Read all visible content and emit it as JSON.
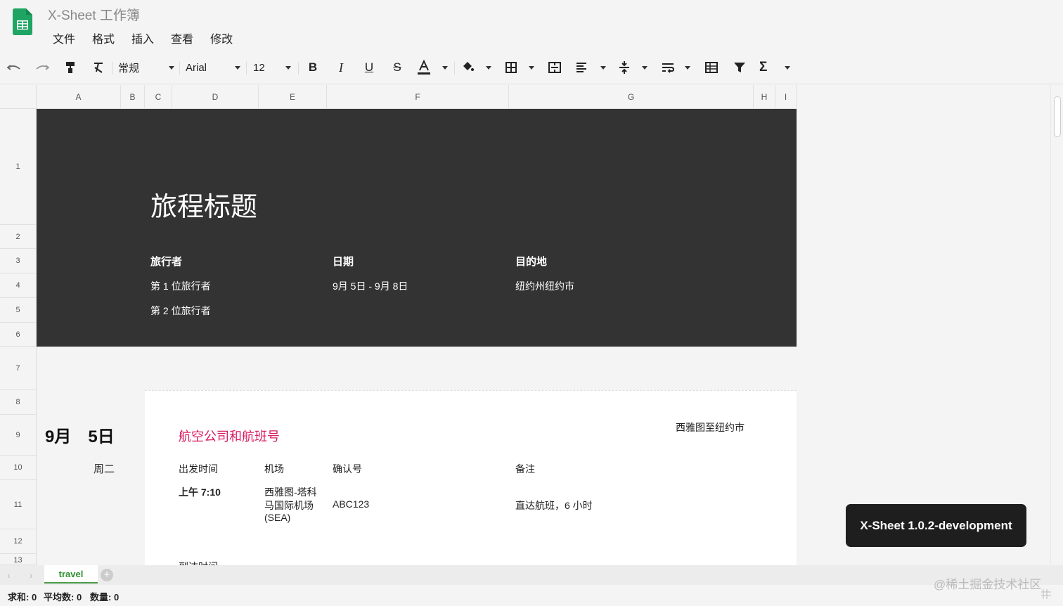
{
  "app": {
    "title": "X-Sheet 工作簿"
  },
  "menu": [
    "文件",
    "格式",
    "插入",
    "查看",
    "修改"
  ],
  "toolbar": {
    "format": "常规",
    "font": "Arial",
    "font_size": "12"
  },
  "columns": [
    "A",
    "B",
    "C",
    "D",
    "E",
    "F",
    "G",
    "H",
    "I"
  ],
  "rows": [
    "1",
    "2",
    "3",
    "4",
    "5",
    "6",
    "7",
    "8",
    "9",
    "10",
    "11",
    "12",
    "13"
  ],
  "sheet": {
    "title": "旅程标题",
    "traveler_label": "旅行者",
    "traveler_1": "第 1 位旅行者",
    "traveler_2": "第 2 位旅行者",
    "date_label": "日期",
    "date_value": "9月 5日 - 9月 8日",
    "dest_label": "目的地",
    "dest_value": "纽约州纽约市",
    "day_date": "9月　5日",
    "day_weekday": "周二",
    "flight_title": "航空公司和航班号",
    "route": "西雅图至纽约市",
    "dep_time_label": "出发时间",
    "airport_label": "机场",
    "confirm_label": "确认号",
    "notes_label": "备注",
    "dep_time": "上午 7:10",
    "airport_line1": "西雅图-塔科",
    "airport_line2": "马国际机场",
    "airport_line3": "(SEA)",
    "confirm_value": "ABC123",
    "notes_value": "直达航班，6 小时",
    "arrive_label": "到达时间"
  },
  "tabs": [
    {
      "label": "travel"
    }
  ],
  "status": {
    "sum": "求和: 0",
    "avg": "平均数: 0",
    "count": "数量: 0"
  },
  "toast": "X-Sheet 1.0.2-development",
  "watermark": "@稀土掘金技术社区",
  "colors": {
    "accent": "#d81b60",
    "banner": "#333333",
    "tab_green": "#2f8f2f"
  }
}
